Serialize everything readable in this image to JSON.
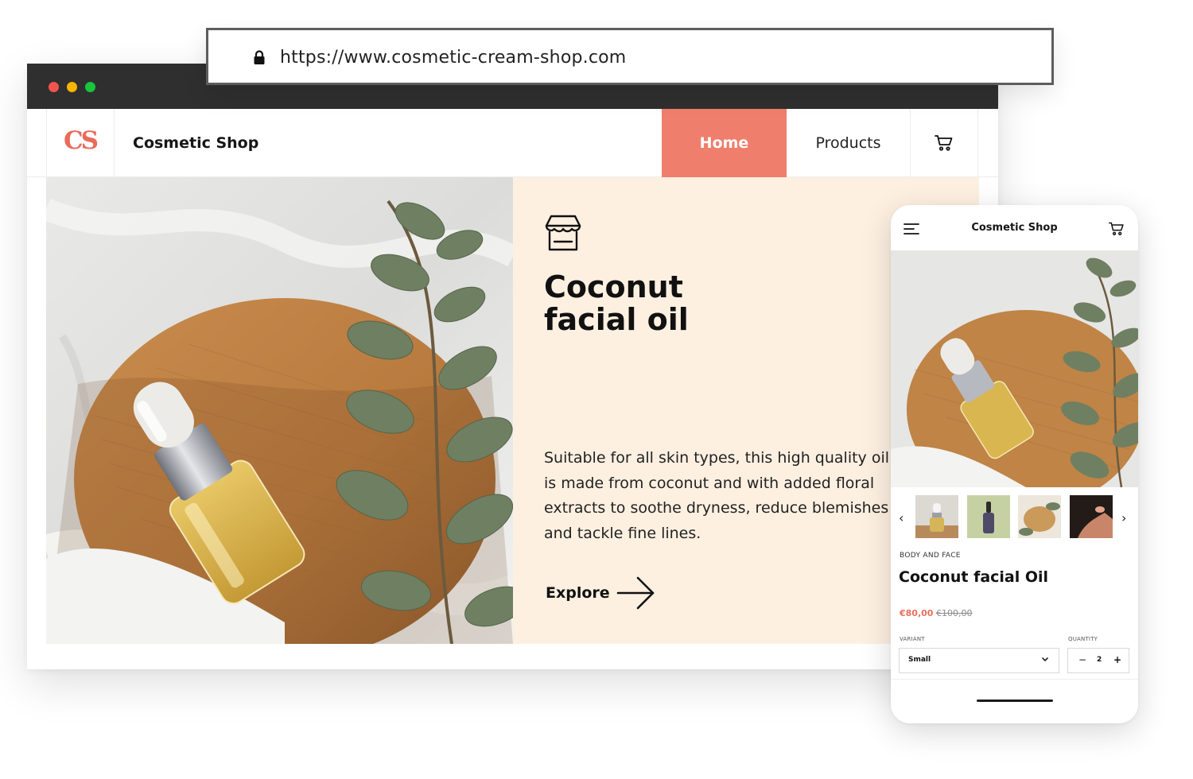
{
  "browser": {
    "url": "https://www.cosmetic-cream-shop.com",
    "icons": {
      "lock": "lock-icon"
    }
  },
  "site": {
    "logo": "CS",
    "name": "Cosmetic Shop",
    "nav": {
      "home": "Home",
      "products": "Products",
      "cart_icon": "cart-icon"
    },
    "active_nav_color": "#ef7e6c"
  },
  "hero": {
    "icon": "store-icon",
    "title": "Coconut facial oil",
    "description": "Suitable for all skin types, this high quality oil is made from coconut and with added floral extracts to soothe dryness, reduce blemishes and tackle fine lines.",
    "cta": "Explore",
    "panel_color": "#fdf0e1"
  },
  "mobile": {
    "title": "Cosmetic Shop",
    "category": "BODY AND FACE",
    "product_name": "Coconut facial Oil",
    "price": "€80,00",
    "old_price": "€100,00",
    "variant_label": "VARIANT",
    "variant_value": "Small",
    "quantity_label": "QUANTITY",
    "quantity_value": "2",
    "minus": "−",
    "plus": "+",
    "prev": "‹",
    "next": "›",
    "price_color": "#e8705e"
  }
}
